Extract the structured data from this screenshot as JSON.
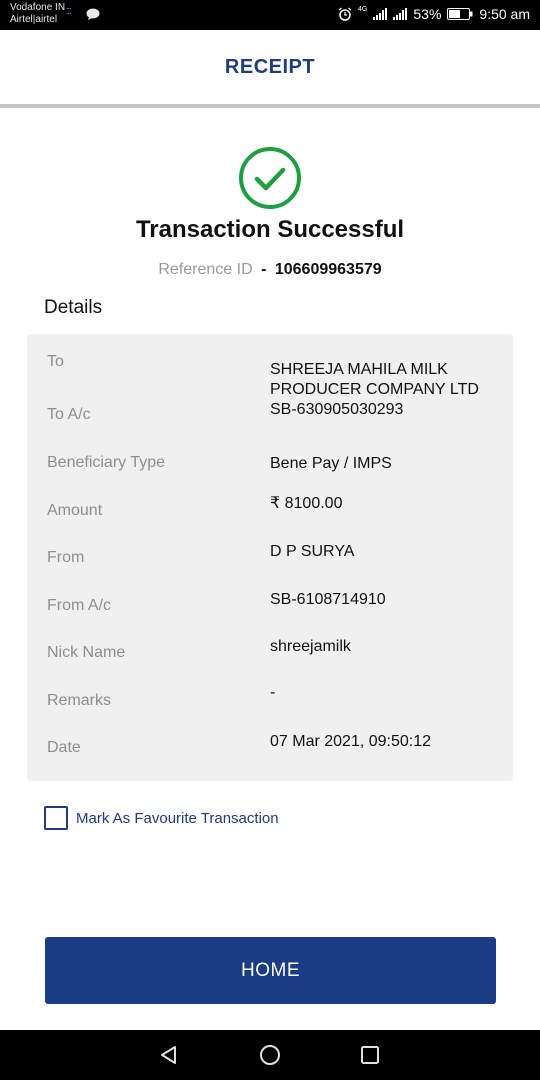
{
  "status_bar": {
    "carrier_line1": "Vodafone IN",
    "carrier_line2": "Airtel|airtel",
    "net_tag": "4G",
    "battery": "53%",
    "time": "9:50 am"
  },
  "header": {
    "title": "RECEIPT"
  },
  "status": {
    "title": "Transaction Successful",
    "reference_label": "Reference ID",
    "reference_separator": "-",
    "reference_value": "106609963579",
    "icon": "check-circle-icon",
    "icon_color": "#1e9e3e"
  },
  "details": {
    "heading": "Details",
    "rows": [
      {
        "label": "To",
        "value": "SHREEJA MAHILA MILK PRODUCER COMPANY LTD"
      },
      {
        "label": "To A/c",
        "value": "SB-630905030293"
      },
      {
        "label": "Beneficiary Type",
        "value": "Bene Pay / IMPS"
      },
      {
        "label": "Amount",
        "value": "₹ 8100.00"
      },
      {
        "label": "From",
        "value": "D P SURYA"
      },
      {
        "label": "From A/c",
        "value": "SB-6108714910"
      },
      {
        "label": "Nick Name",
        "value": "shreejamilk"
      },
      {
        "label": "Remarks",
        "value": "-"
      },
      {
        "label": "Date",
        "value": "07 Mar 2021, 09:50:12"
      }
    ]
  },
  "favourite": {
    "label": "Mark As Favourite Transaction",
    "checked": false
  },
  "home_button": {
    "label": "HOME"
  },
  "theme": {
    "primary": "#1a3c85",
    "success": "#1e9e3e"
  }
}
